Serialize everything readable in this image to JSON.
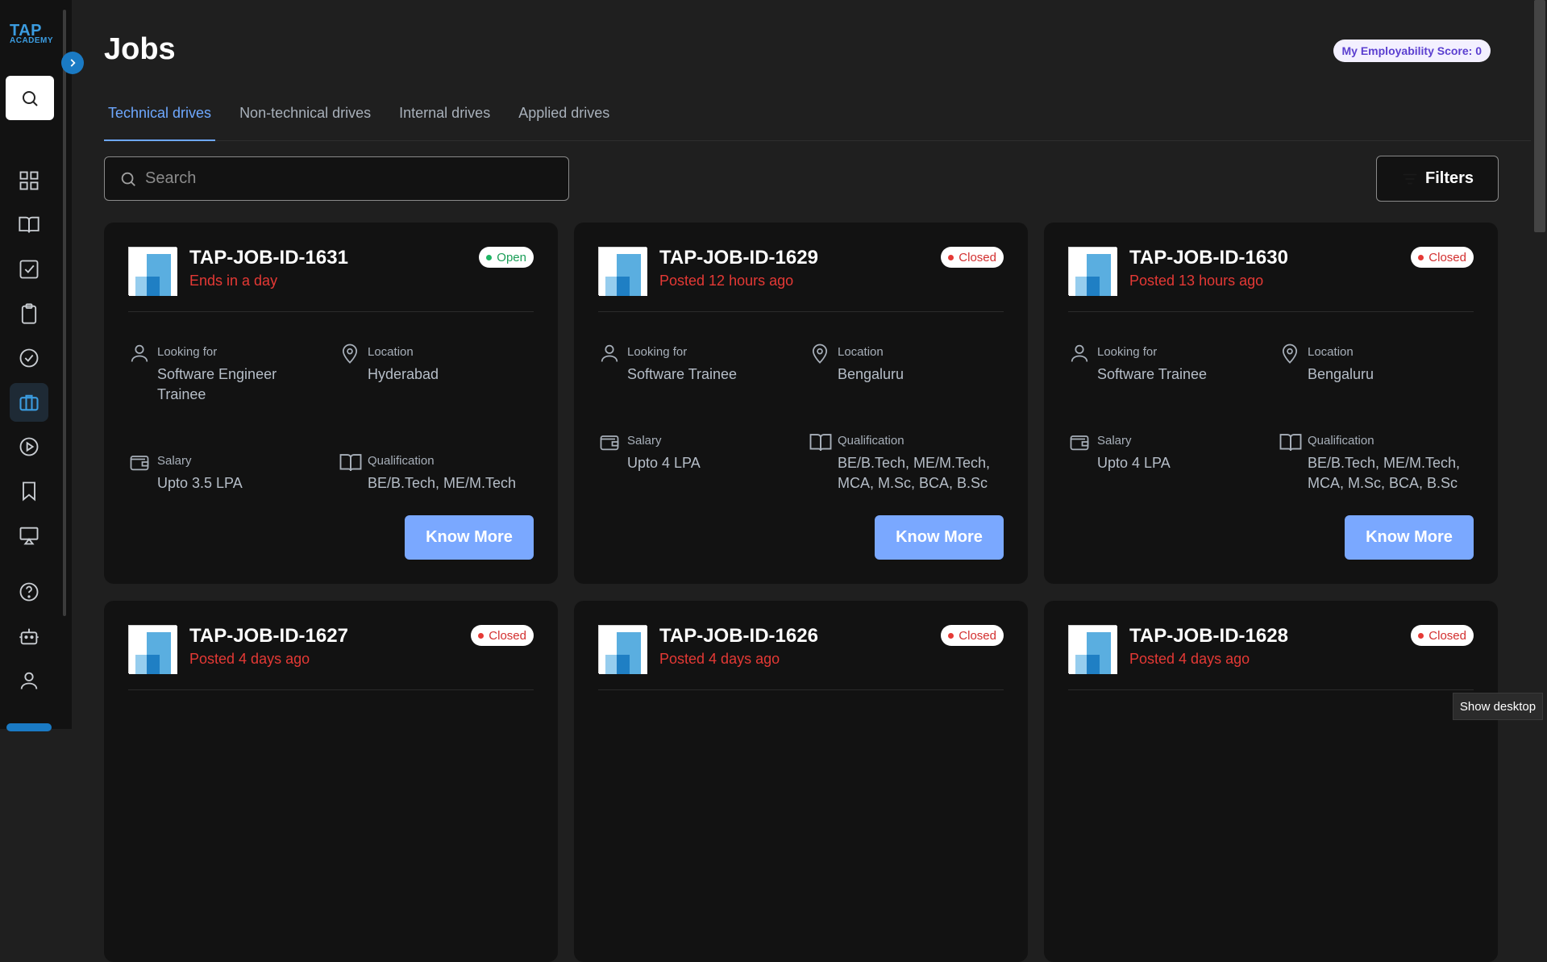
{
  "sidebar": {
    "logo_line1": "TAP",
    "logo_line2": "ACADEMY",
    "nav": [
      "dashboard-icon",
      "book-icon",
      "checklist-icon",
      "clipboard-icon",
      "check-circle-icon",
      "briefcase-icon",
      "play-icon",
      "bookmark-icon",
      "cast-icon",
      "help-icon",
      "bot-icon",
      "user-icon"
    ],
    "active": "briefcase-icon"
  },
  "header": {
    "title": "Jobs",
    "score_label": "My Employability Score: 0"
  },
  "tabs": [
    "Technical drives",
    "Non-technical drives",
    "Internal drives",
    "Applied drives"
  ],
  "search": {
    "placeholder": "Search"
  },
  "filters_label": "Filters",
  "colors": {
    "accent": "#6ea8ff",
    "button": "#7aa8ff",
    "alert": "#e53935",
    "open": "#1fb564"
  },
  "jobs": [
    {
      "id": "TAP-JOB-ID-1631",
      "sub": "Ends in a day",
      "status": "Open",
      "looking_label": "Looking for",
      "looking": "Software Engineer Trainee",
      "location_label": "Location",
      "location": "Hyderabad",
      "salary_label": "Salary",
      "salary": "Upto 3.5 LPA",
      "qual_label": "Qualification",
      "qual": "BE/B.Tech, ME/M.Tech",
      "button": "Know More"
    },
    {
      "id": "TAP-JOB-ID-1629",
      "sub": "Posted 12 hours ago",
      "status": "Closed",
      "looking_label": "Looking for",
      "looking": "Software Trainee",
      "location_label": "Location",
      "location": "Bengaluru",
      "salary_label": "Salary",
      "salary": "Upto 4 LPA",
      "qual_label": "Qualification",
      "qual": "BE/B.Tech, ME/M.Tech, MCA, M.Sc, BCA, B.Sc",
      "button": "Know More"
    },
    {
      "id": "TAP-JOB-ID-1630",
      "sub": "Posted 13 hours ago",
      "status": "Closed",
      "looking_label": "Looking for",
      "looking": "Software Trainee",
      "location_label": "Location",
      "location": "Bengaluru",
      "salary_label": "Salary",
      "salary": "Upto 4 LPA",
      "qual_label": "Qualification",
      "qual": "BE/B.Tech, ME/M.Tech, MCA, M.Sc, BCA, B.Sc",
      "button": "Know More"
    },
    {
      "id": "TAP-JOB-ID-1627",
      "sub": "Posted 4 days ago",
      "status": "Closed"
    },
    {
      "id": "TAP-JOB-ID-1626",
      "sub": "Posted 4 days ago",
      "status": "Closed"
    },
    {
      "id": "TAP-JOB-ID-1628",
      "sub": "Posted 4 days ago",
      "status": "Closed"
    }
  ],
  "tooltip": "Show desktop"
}
